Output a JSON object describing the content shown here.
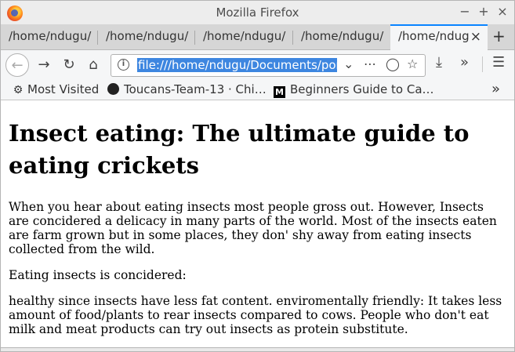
{
  "window": {
    "title": "Mozilla Firefox",
    "controls": [
      "−",
      "+",
      "×"
    ]
  },
  "tabs": [
    {
      "label": "/home/ndugu/"
    },
    {
      "label": "/home/ndugu/"
    },
    {
      "label": "/home/ndugu/"
    },
    {
      "label": "/home/ndugu/"
    },
    {
      "label": "/home/ndug",
      "active": true
    }
  ],
  "toolbar": {
    "url": "file:///home/ndugu/Documents/por"
  },
  "bookmarks": [
    {
      "label": "Most Visited",
      "icon": "gear-icon"
    },
    {
      "label": "Toucans-Team-13 · Chi…",
      "icon": "github-icon"
    },
    {
      "label": "Beginners Guide to Ca…",
      "icon": "medium-icon"
    }
  ],
  "page": {
    "heading": "Insect eating: The ultimate guide to eating crickets",
    "paragraphs": [
      "When you hear about eating insects most people gross out. However, Insects are concidered a delicacy in many parts of the world. Most of the insects eaten are farm grown but in some places, they don' shy away from eating insects collected from the wild.",
      "Eating insects is concidered:",
      "healthy since insects have less fat content. enviromentally friendly: It takes less amount of food/plants to rear insects compared to cows. People who don't eat milk and meat products can try out insects as protein substitute."
    ]
  }
}
